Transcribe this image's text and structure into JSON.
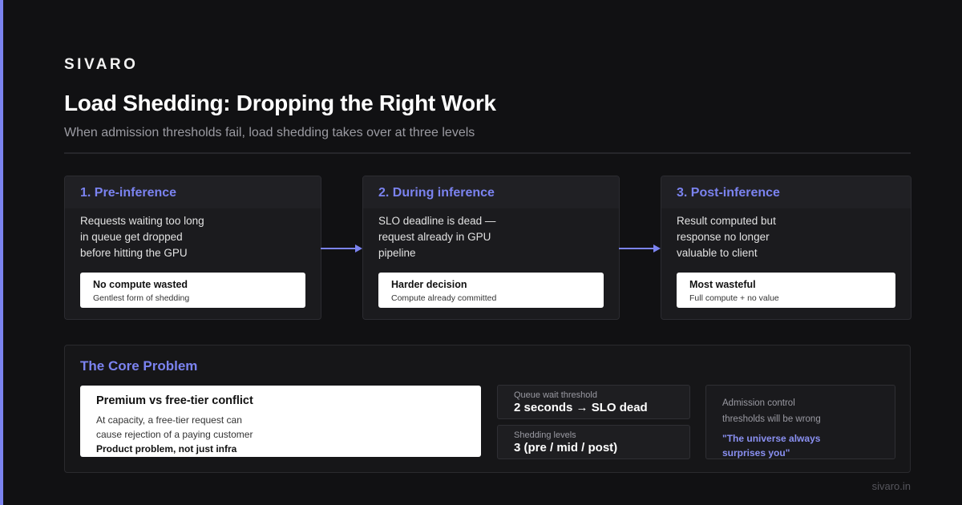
{
  "brand": "SIVARO",
  "title": "Load Shedding: Dropping the Right Work",
  "subtitle": "When admission thresholds fail, load shedding takes over at three levels",
  "colors": {
    "accent": "#7b83f0",
    "background": "#111113",
    "card": "#1b1b1e",
    "note": "#ffffff"
  },
  "stages": [
    {
      "title": "1. Pre-inference",
      "lines": [
        "Requests waiting too long",
        "in queue get dropped",
        "before hitting the GPU"
      ],
      "note_title": "No compute wasted",
      "note_sub": "Gentlest form of shedding"
    },
    {
      "title": "2. During inference",
      "lines": [
        "SLO deadline is dead —",
        "request already in GPU",
        "pipeline"
      ],
      "note_title": "Harder decision",
      "note_sub": "Compute already committed"
    },
    {
      "title": "3. Post-inference",
      "lines": [
        "Result computed but",
        "response no longer",
        "valuable to client"
      ],
      "note_title": "Most wasteful",
      "note_sub": "Full compute + no value"
    }
  ],
  "core": {
    "title": "The Core Problem",
    "conflict_title": "Premium vs free-tier conflict",
    "conflict_lines": [
      "At capacity, a free-tier request can",
      "cause rejection of a paying customer"
    ],
    "conflict_emphasis": "Product problem, not just infra",
    "metrics": [
      {
        "label": "Queue wait threshold",
        "value": "2 seconds → SLO dead"
      },
      {
        "label": "Shedding levels",
        "value": "3 (pre / mid / post)"
      }
    ],
    "quote_lines": [
      "Admission control",
      "thresholds will be wrong"
    ],
    "quote": [
      "\"The universe always",
      "surprises you\""
    ]
  },
  "footer": "sivaro.in"
}
